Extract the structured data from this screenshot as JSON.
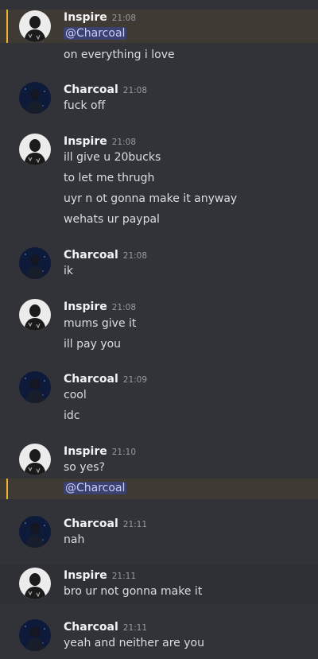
{
  "messages": [
    {
      "user": "Inspire",
      "time": "21:08",
      "lines": [
        "@Charcoal",
        "on everything i love"
      ]
    },
    {
      "user": "Charcoal",
      "time": "21:08",
      "lines": [
        "fuck off"
      ]
    },
    {
      "user": "Inspire",
      "time": "21:08",
      "lines": [
        "ill give u 20bucks",
        "to let me thrugh",
        "uyr n ot gonna make it anyway",
        "wehats ur paypal"
      ]
    },
    {
      "user": "Charcoal",
      "time": "21:08",
      "lines": [
        "ik"
      ]
    },
    {
      "user": "Inspire",
      "time": "21:08",
      "lines": [
        "mums give it",
        "ill pay you"
      ]
    },
    {
      "user": "Charcoal",
      "time": "21:09",
      "lines": [
        "cool",
        "idc"
      ]
    },
    {
      "user": "Inspire",
      "time": "21:10",
      "lines": [
        "so yes?",
        "@Charcoal"
      ]
    },
    {
      "user": "Charcoal",
      "time": "21:11",
      "lines": [
        "nah"
      ]
    },
    {
      "user": "Inspire",
      "time": "21:11",
      "lines": [
        "bro ur not gonna make it"
      ]
    },
    {
      "user": "Charcoal",
      "time": "21:11",
      "lines": [
        "yeah and neither are you"
      ]
    }
  ],
  "colors": {
    "background": "#313338",
    "mention_highlight": "#3f3b34",
    "mention_bar": "#f0b232",
    "mention_pill": "#3c4270"
  },
  "icons": {
    "inspire_avatar": "avatar-inspire-icon",
    "charcoal_avatar": "avatar-charcoal-icon"
  }
}
